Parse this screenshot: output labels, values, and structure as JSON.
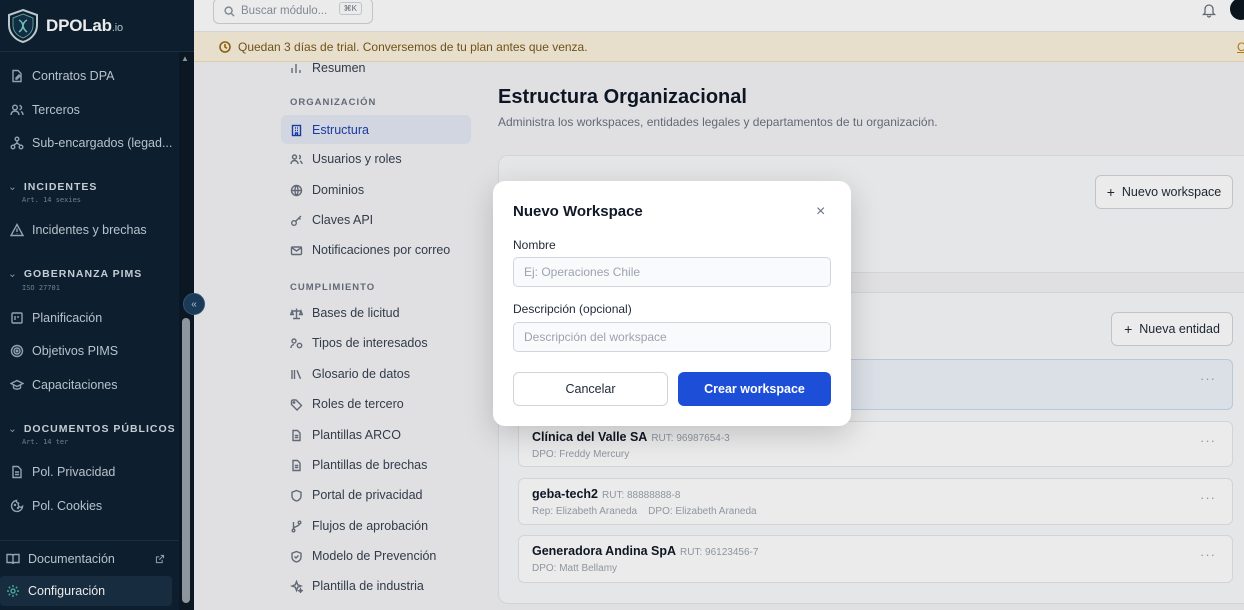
{
  "brand": {
    "name": "DPOLab",
    "suffix": ".io"
  },
  "search": {
    "placeholder": "Buscar módulo...",
    "shortcut": "⌘K"
  },
  "banner": {
    "text": "Quedan 3 días de trial. Conversemos de tu plan antes que venza.",
    "link": "C"
  },
  "sidebar": {
    "items_top": [
      {
        "label": "Contratos DPA",
        "icon": "file-edit-icon"
      },
      {
        "label": "Terceros",
        "icon": "users-icon"
      },
      {
        "label": "Sub-encargados (legad...",
        "icon": "network-icon"
      }
    ],
    "section_incidentes": {
      "title": "INCIDENTES",
      "sub": "Art. 14 sexies"
    },
    "item_incidentes": {
      "label": "Incidentes y brechas",
      "icon": "alert-triangle-icon"
    },
    "section_gobernanza": {
      "title": "GOBERNANZA PIMS",
      "sub": "ISO 27701"
    },
    "items_gobernanza": [
      {
        "label": "Planificación",
        "icon": "calendar-icon"
      },
      {
        "label": "Objetivos PIMS",
        "icon": "target-icon"
      },
      {
        "label": "Capacitaciones",
        "icon": "graduation-cap-icon"
      }
    ],
    "section_documentos": {
      "title": "DOCUMENTOS PÚBLICOS",
      "sub": "Art. 14 ter"
    },
    "items_documentos": [
      {
        "label": "Pol. Privacidad",
        "icon": "document-icon"
      },
      {
        "label": "Pol. Cookies",
        "icon": "cookie-icon"
      }
    ],
    "documentacion": "Documentación",
    "configuracion": "Configuración"
  },
  "settings_nav": {
    "resumen": "Resumen",
    "head_org": "ORGANIZACIÓN",
    "org_items": [
      {
        "label": "Estructura",
        "icon": "building-icon",
        "active": true
      },
      {
        "label": "Usuarios y roles",
        "icon": "users-icon"
      },
      {
        "label": "Dominios",
        "icon": "globe-icon"
      },
      {
        "label": "Claves API",
        "icon": "key-icon"
      },
      {
        "label": "Notificaciones por correo",
        "icon": "mail-icon"
      }
    ],
    "head_cump": "CUMPLIMIENTO",
    "cump_items": [
      {
        "label": "Bases de licitud",
        "icon": "scale-icon"
      },
      {
        "label": "Tipos de interesados",
        "icon": "user-group-icon"
      },
      {
        "label": "Glosario de datos",
        "icon": "library-icon"
      },
      {
        "label": "Roles de tercero",
        "icon": "tag-icon"
      },
      {
        "label": "Plantillas ARCO",
        "icon": "file-text-icon"
      },
      {
        "label": "Plantillas de brechas",
        "icon": "file-text-icon"
      },
      {
        "label": "Portal de privacidad",
        "icon": "shield-icon"
      },
      {
        "label": "Flujos de aprobación",
        "icon": "git-branch-icon"
      },
      {
        "label": "Modelo de Prevención",
        "icon": "shield-check-icon"
      },
      {
        "label": "Plantilla de industria",
        "icon": "sparkles-icon"
      }
    ]
  },
  "main": {
    "title": "Estructura Organizacional",
    "subtitle": "Administra los workspaces, entidades legales y departamentos de tu organización.",
    "new_workspace": "Nuevo workspace",
    "new_entity": "Nueva entidad",
    "entities": [
      {
        "name": "Clínica del Valle SA",
        "rut": "RUT: 96987654-3",
        "meta": "DPO: Freddy Mercury"
      },
      {
        "name": "geba-tech2",
        "rut": "RUT: 88888888-8",
        "meta": "Rep: Elizabeth Araneda    DPO: Elizabeth Araneda"
      },
      {
        "name": "Generadora Andina SpA",
        "rut": "RUT: 96123456-7",
        "meta": "DPO: Matt Bellamy"
      }
    ],
    "more": "···"
  },
  "modal": {
    "title": "Nuevo Workspace",
    "close": "×",
    "name_label": "Nombre",
    "name_placeholder": "Ej: Operaciones Chile",
    "desc_label": "Descripción (opcional)",
    "desc_placeholder": "Descripción del workspace",
    "cancel": "Cancelar",
    "submit": "Crear workspace"
  },
  "colors": {
    "sidebar_bg": "#0f2233",
    "primary": "#1d4ed8",
    "banner_bg": "#fbf1dd",
    "active_nav": "#e3e9f3"
  }
}
